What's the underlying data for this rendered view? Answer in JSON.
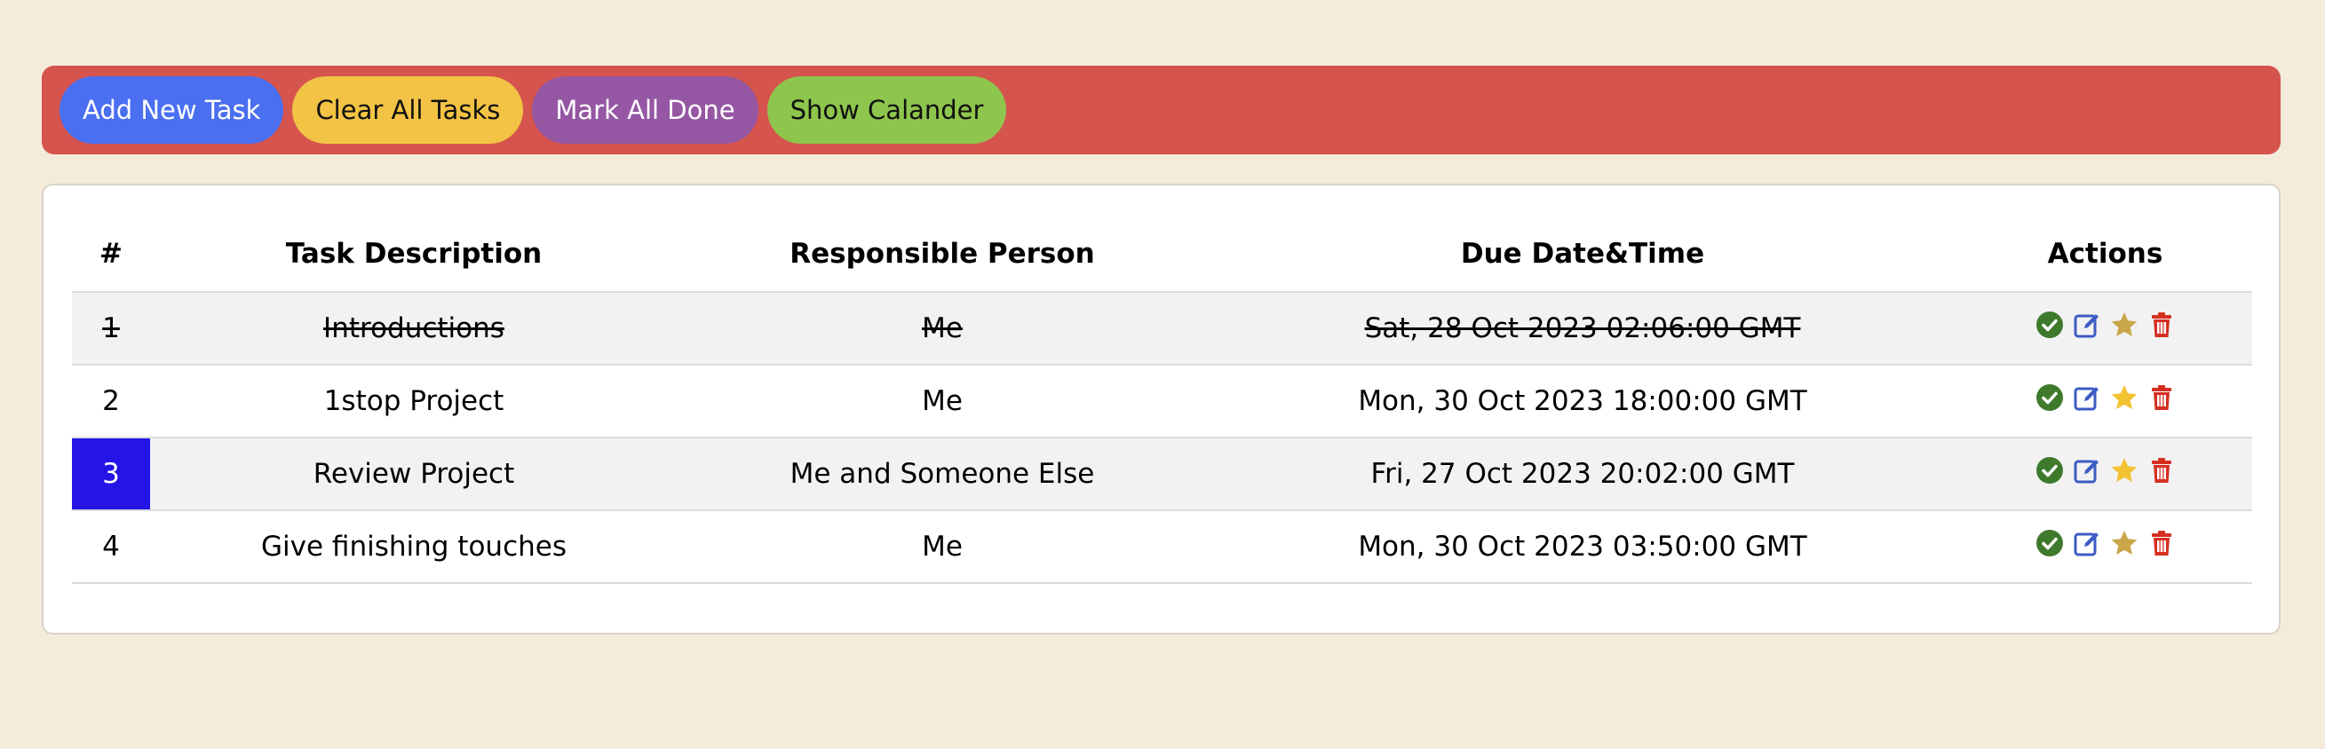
{
  "toolbar": {
    "add_label": "Add New Task",
    "clear_label": "Clear All Tasks",
    "mark_label": "Mark All Done",
    "calendar_label": "Show Calander"
  },
  "table": {
    "headers": {
      "num": "#",
      "task": "Task Description",
      "person": "Responsible Person",
      "due": "Due Date&Time",
      "actions": "Actions"
    },
    "rows": [
      {
        "num": "1",
        "task": "Introductions",
        "person": "Me",
        "due": "Sat, 28 Oct 2023 02:06:00 GMT",
        "done": true,
        "starred": true
      },
      {
        "num": "2",
        "task": "1stop Project",
        "person": "Me",
        "due": "Mon, 30 Oct 2023 18:00:00 GMT",
        "done": false,
        "starred": false
      },
      {
        "num": "3",
        "task": "Review Project",
        "person": "Me and Someone Else",
        "due": "Fri, 27 Oct 2023 20:02:00 GMT",
        "done": false,
        "starred": false,
        "highlight": "#2414e6"
      },
      {
        "num": "4",
        "task": "Give finishing touches",
        "person": "Me",
        "due": "Mon, 30 Oct 2023 03:50:00 GMT",
        "done": false,
        "starred": true
      }
    ],
    "icons": [
      "check-circle-icon",
      "edit-icon",
      "star-icon",
      "trash-icon"
    ]
  },
  "colors": {
    "background": "#f5ebda",
    "toolbar": "#d5544e",
    "add": "#4a6ff0",
    "clear": "#f2c344",
    "mark": "#9557a3",
    "calendar": "#8ec54c",
    "check": "#3f7a2c",
    "edit": "#3c5bc4",
    "star_on": "#c9a64a",
    "star_off": "#f2c232",
    "trash": "#d62f22"
  }
}
